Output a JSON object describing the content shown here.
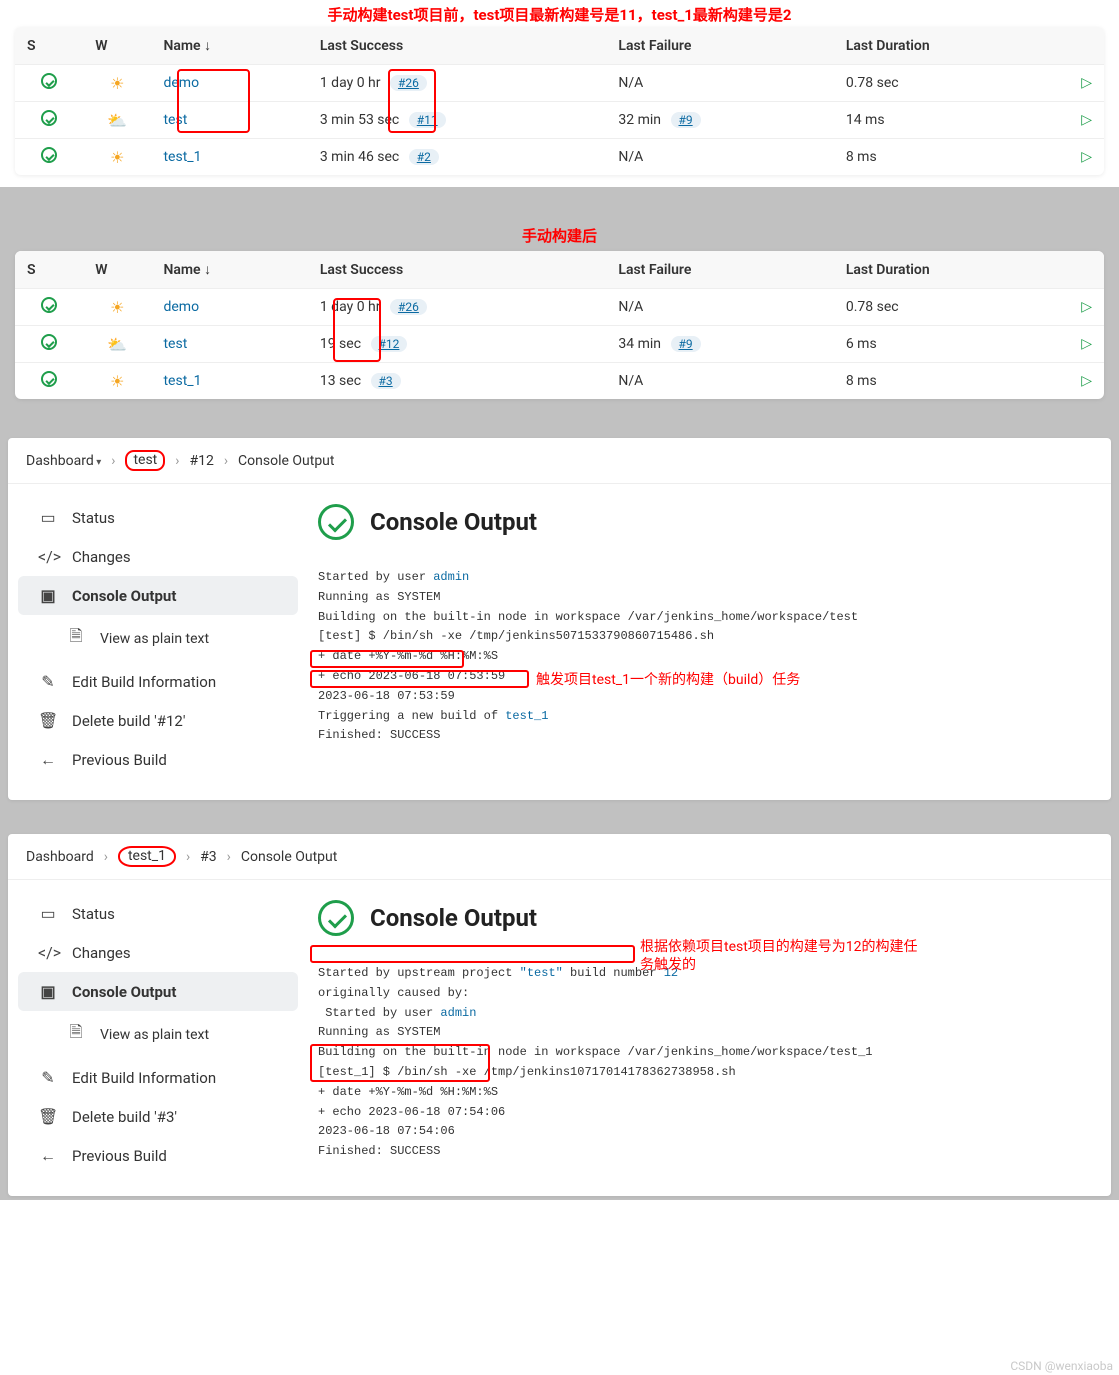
{
  "annotations": {
    "top_caption": "手动构建test项目前，test项目最新构建号是11，test_1最新构建号是2",
    "after_caption": "手动构建后",
    "trigger_note": "触发项目test_1一个新的构建（build）任务",
    "upstream_note": "根据依赖项目test项目的构建号为12的构建任务触发的",
    "watermark": "CSDN @wenxiaoba"
  },
  "table_headers": {
    "s": "S",
    "w": "W",
    "name": "Name ↓",
    "last_success": "Last Success",
    "last_failure": "Last Failure",
    "last_duration": "Last Duration"
  },
  "table1": {
    "rows": [
      {
        "name": "demo",
        "success_text": "1 day 0 hr",
        "success_build": "#26",
        "failure_text": "N/A",
        "failure_build": "",
        "duration": "0.78 sec",
        "weather": "sun"
      },
      {
        "name": "test",
        "success_text": "3 min 53 sec",
        "success_build": "#11",
        "failure_text": "32 min",
        "failure_build": "#9",
        "duration": "14 ms",
        "weather": "cloud"
      },
      {
        "name": "test_1",
        "success_text": "3 min 46 sec",
        "success_build": "#2",
        "failure_text": "N/A",
        "failure_build": "",
        "duration": "8 ms",
        "weather": "sun"
      }
    ]
  },
  "table2": {
    "rows": [
      {
        "name": "demo",
        "success_text": "1 day 0 hr",
        "success_build": "#26",
        "failure_text": "N/A",
        "failure_build": "",
        "duration": "0.78 sec",
        "weather": "sun"
      },
      {
        "name": "test",
        "success_text": "19 sec",
        "success_build": "#12",
        "failure_text": "34 min",
        "failure_build": "#9",
        "duration": "6 ms",
        "weather": "cloud"
      },
      {
        "name": "test_1",
        "success_text": "13 sec",
        "success_build": "#3",
        "failure_text": "N/A",
        "failure_build": "",
        "duration": "8 ms",
        "weather": "sun"
      }
    ]
  },
  "breadcrumb": {
    "dashboard": "Dashboard",
    "console_output": "Console Output"
  },
  "sidebar": {
    "status": "Status",
    "changes": "Changes",
    "console_output": "Console Output",
    "view_plain": "View as plain text",
    "edit_build": "Edit Build Information",
    "previous_build": "Previous Build"
  },
  "console1": {
    "project": "test",
    "build_num": "#12",
    "delete_label": "Delete build '#12'",
    "title": "Console Output",
    "lines_pre": "Started by user ",
    "admin": "admin",
    "lines_body": "Running as SYSTEM\nBuilding on the built-in node in workspace /var/jenkins_home/workspace/test\n[test] $ /bin/sh -xe /tmp/jenkins5071533790860715486.sh\n+ date +%Y-%m-%d %H:%M:%S\n+ echo 2023-06-18 07:53:59\n2023-06-18 07:53:59\nTriggering a new build of ",
    "trigger_link": "test_1",
    "finished": "Finished: SUCCESS"
  },
  "console2": {
    "project": "test_1",
    "build_num": "#3",
    "delete_label": "Delete build '#3'",
    "title": "Console Output",
    "started_pre": "Started by upstream project ",
    "up_project": "\"test\"",
    "started_mid": " build number ",
    "up_build": "12",
    "originally": "originally caused by:",
    "started_user_pre": " Started by user ",
    "admin": "admin",
    "rest1": "Running as SYSTEM\nBuilding on the built-in node in workspace /var/jenkins_home/workspace/test_1\n[test_1] $ /bin/sh -xe /tmp/jenkins10717014178362738958.sh\n+ date +%Y-%m-%d %H:%M:%S",
    "echo_line": "+ echo 2023-06-18 07:54:06\n2023-06-18 07:54:06",
    "finished": "Finished: SUCCESS"
  }
}
